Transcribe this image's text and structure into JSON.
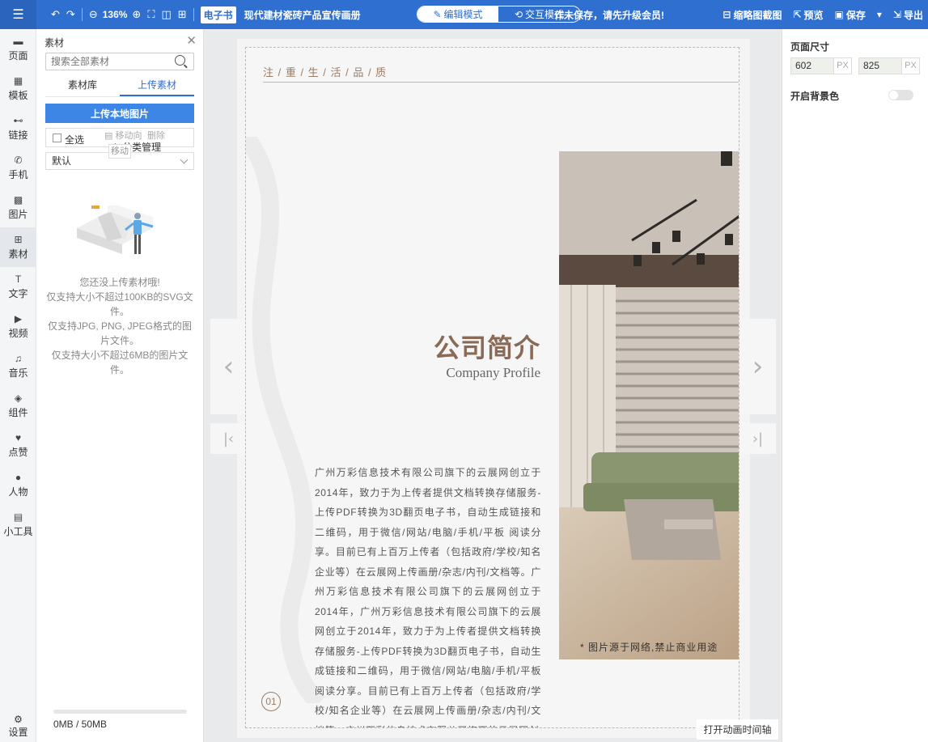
{
  "toolbar": {
    "zoom": "136%",
    "badge": "电子书",
    "doc_title": "现代建材瓷砖产品宣传画册",
    "mode_edit": "编辑模式",
    "mode_interact": "交互模式",
    "notice": "作未保存，请先升级会员!",
    "thumbnail": "缩略图截图",
    "preview": "预览",
    "save": "保存",
    "export": "导出"
  },
  "leftnav": {
    "items": [
      {
        "label": "页面",
        "icon": "page-icon"
      },
      {
        "label": "模板",
        "icon": "template-icon"
      },
      {
        "label": "链接",
        "icon": "link-icon"
      },
      {
        "label": "手机",
        "icon": "phone-icon"
      },
      {
        "label": "图片",
        "icon": "image-icon"
      },
      {
        "label": "素材",
        "icon": "material-icon"
      },
      {
        "label": "文字",
        "icon": "text-icon"
      },
      {
        "label": "视频",
        "icon": "video-icon"
      },
      {
        "label": "音乐",
        "icon": "music-icon"
      },
      {
        "label": "组件",
        "icon": "component-icon"
      },
      {
        "label": "点赞",
        "icon": "heart-icon"
      },
      {
        "label": "人物",
        "icon": "person-icon"
      },
      {
        "label": "小工具",
        "icon": "toolbox-icon"
      }
    ],
    "settings": "设置"
  },
  "panel": {
    "title": "素材",
    "search_placeholder": "搜索全部素材",
    "tab_library": "素材库",
    "tab_upload": "上传素材",
    "upload_button": "上传本地图片",
    "select_all": "全选",
    "move_to": "移动向",
    "delete": "删除",
    "category_manage": "分类管理",
    "move_tooltip": "移动",
    "category_default": "默认",
    "empty_lines": [
      "您还没上传素材哦!",
      "仅支持大小不超过100KB的SVG文件。",
      "仅支持JPG, PNG, JPEG格式的图片文件。",
      "仅支持大小不超过6MB的图片文件。"
    ],
    "quota": "0MB / 50MB",
    "quota_used_fraction": 0
  },
  "page": {
    "slogan": "注 / 重 / 生 / 活 / 品 / 质",
    "title_cn": "公司简介",
    "title_en": "Company Profile",
    "body": "广州万彩信息技术有限公司旗下的云展网创立于2014年，致力于为上传者提供文档转换存储服务-上传PDF转换为3D翻页电子书，自动生成链接和二维码，用于微信/网站/电脑/手机/平板 阅读分享。目前已有上百万上传者（包括政府/学校/知名企业等）在云展网上传画册/杂志/内刊/文档等。广州万彩信息技术有限公司旗下的云展网创立于2014年，广州万彩信息技术有限公司旗下的云展网创立于2014年，致力于为上传者提供文档转换存储服务-上传PDF转换为3D翻页电子书，自动生成链接和二维码，用于微信/网站/电脑/手机/平板阅读分享。目前已有上百万上传者（包括政府/学校/知名企业等）在云展网上传画册/杂志/内刊/文档等。广州万彩信息技术有限公司旗下的云展网创",
    "photo_caption": "* 图片源于网络,禁止商业用途",
    "page_number": "01",
    "timeline_button": "打开动画时间轴"
  },
  "rpanel": {
    "page_size_label": "页面尺寸",
    "width": "602",
    "height": "825",
    "unit": "PX",
    "bg_color_label": "开启背景色",
    "bg_enabled": false
  },
  "colors": {
    "primary": "#2e6fd0",
    "button": "#3d86e6",
    "accent_brown": "#8a6a56"
  }
}
